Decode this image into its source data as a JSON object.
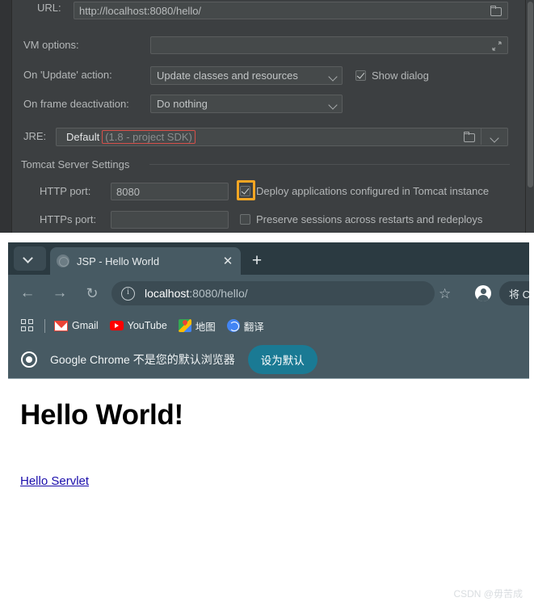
{
  "ide": {
    "url_row": {
      "label": "URL:",
      "value": "http://localhost:8080/hello/",
      "browse_icon": "folder-icon"
    },
    "vm_options_row": {
      "label": "VM options:",
      "value": "",
      "expand_icon": "expand-icon"
    },
    "update_action_row": {
      "label": "On 'Update' action:",
      "value": "Update classes and resources",
      "chevron_icon": "chevron-down-icon"
    },
    "show_dialog": {
      "label": "Show dialog",
      "checked": true
    },
    "frame_deactivation_row": {
      "label": "On frame deactivation:",
      "value": "Do nothing",
      "chevron_icon": "chevron-down-icon"
    },
    "jre_row": {
      "label": "JRE:",
      "value": "Default",
      "sdk_note": "(1.8 - project SDK)",
      "folder_icon": "folder-icon",
      "chevron_icon": "chevron-down-icon"
    },
    "tomcat_group": {
      "title": "Tomcat Server Settings"
    },
    "http_port": {
      "label": "HTTP port:",
      "value": "8080"
    },
    "https_port": {
      "label": "HTTPs port:",
      "value": ""
    },
    "deploy_checkbox": {
      "label": "Deploy applications configured in Tomcat instance",
      "checked": true,
      "highlighted": true
    },
    "preserve_checkbox": {
      "label": "Preserve sessions across restarts and redeploys",
      "checked": false
    },
    "colors": {
      "panel_bg": "#3c3f41",
      "field_bg": "#45494a",
      "text": "#b4b7b8",
      "highlight": "#f5a623",
      "error_border": "#d6504a"
    }
  },
  "browser": {
    "tab_list_icon": "chevron-down-icon",
    "tab": {
      "title": "JSP - Hello World",
      "favicon": "globe-icon",
      "close_icon": "close-icon"
    },
    "new_tab_label": "+",
    "nav": {
      "back_icon": "arrow-left-icon",
      "forward_icon": "arrow-right-icon",
      "reload_icon": "reload-icon"
    },
    "omnibox": {
      "info_icon": "info-circle-icon",
      "host": "localhost",
      "rest": ":8080/hello/"
    },
    "bookmark_star_icon": "star-icon",
    "avatar_icon": "profile-avatar-icon",
    "right_pill_label": "将 Ch",
    "bookmarks": {
      "apps_icon": "apps-grid-icon",
      "items": [
        {
          "label": "Gmail",
          "icon": "gmail-icon"
        },
        {
          "label": "YouTube",
          "icon": "youtube-icon"
        },
        {
          "label": "地图",
          "icon": "google-maps-icon"
        },
        {
          "label": "翻译",
          "icon": "google-translate-icon"
        }
      ]
    },
    "infobar": {
      "logo_icon": "chrome-logo-icon",
      "message": "Google Chrome 不是您的默认浏览器",
      "button_label": "设为默认",
      "button_color": "#1a7a94"
    },
    "page": {
      "heading": "Hello World!",
      "link_text": "Hello Servlet",
      "link_color": "#1a0dab",
      "watermark": "CSDN @毋苦成"
    }
  }
}
